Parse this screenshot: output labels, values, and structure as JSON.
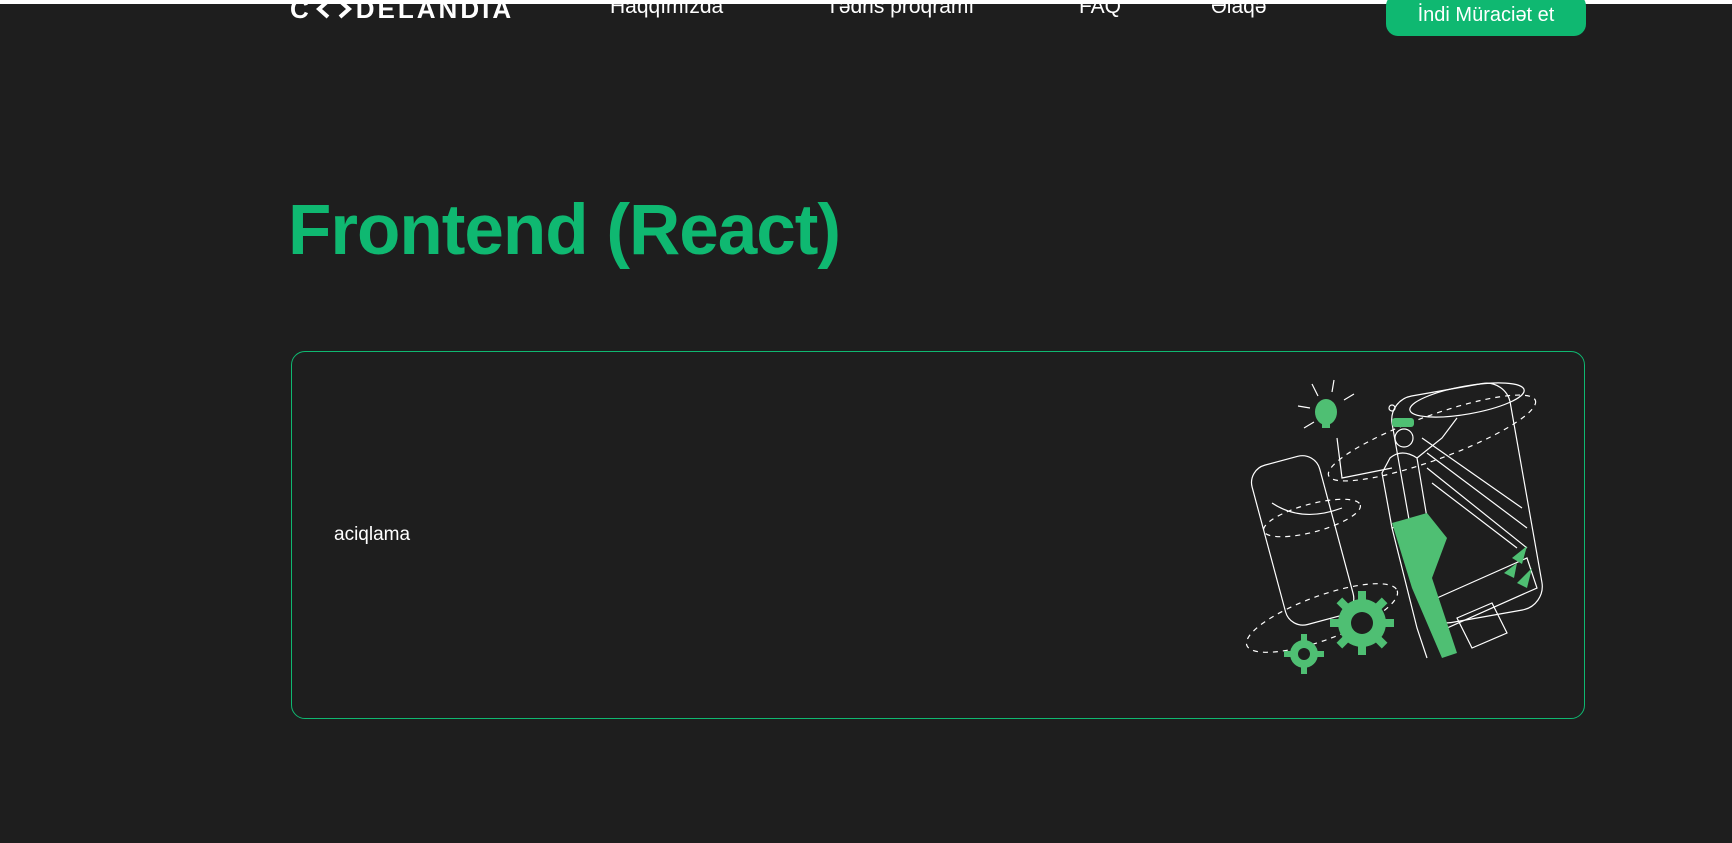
{
  "header": {
    "logo_text": "CODELANDIA",
    "nav": [
      {
        "label": "Haqqımızda"
      },
      {
        "label": "Tədris proqramı"
      },
      {
        "label": "FAQ"
      },
      {
        "label": "Əlaqə"
      }
    ],
    "cta_label": "İndi Müraciət et"
  },
  "main": {
    "title": "Frontend (React)",
    "card": {
      "description": "aciqlama",
      "illustration_icon": "developer-illustration-icon"
    }
  },
  "colors": {
    "accent": "#0fb871",
    "background": "#1e1e1e",
    "text": "#ffffff"
  }
}
